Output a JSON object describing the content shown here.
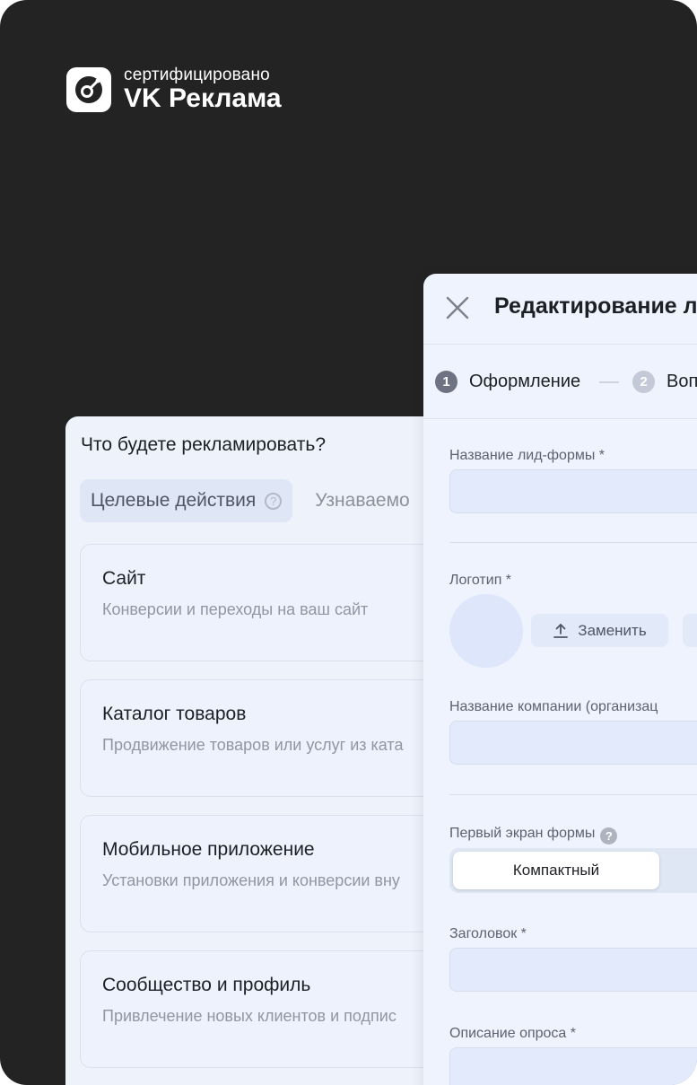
{
  "badge": {
    "subtitle": "сертифицировано",
    "title": "VK Реклама",
    "icon": "vk-ads-logo-icon"
  },
  "objective_panel": {
    "title": "Что будете рекламировать?",
    "tabs": [
      {
        "label": "Целевые действия",
        "active": true,
        "help_icon": "question-circle-icon"
      },
      {
        "label": "Узнаваемо",
        "active": false
      }
    ],
    "cards": [
      {
        "title": "Сайт",
        "description": "Конверсии и переходы на ваш сайт"
      },
      {
        "title": "Каталог товаров",
        "description": "Продвижение товаров или услуг из ката"
      },
      {
        "title": "Мобильное приложение",
        "description": "Установки приложения и конверсии вну"
      },
      {
        "title": "Сообщество и профиль",
        "description": "Привлечение новых клиентов и подпис"
      }
    ]
  },
  "editor_panel": {
    "title": "Редактирование л",
    "close_icon": "close-icon",
    "steps": [
      {
        "num": "1",
        "label": "Оформление",
        "active": true
      },
      {
        "num": "2",
        "label": "Воп",
        "active": false
      }
    ],
    "fields": {
      "form_name_label": "Название лид-формы *",
      "logo_label": "Логотип *",
      "replace_button": "Заменить",
      "company_name_label": "Название компании (организац",
      "first_screen_label": "Первый экран формы",
      "first_screen_option": "Компактный",
      "heading_label": "Заголовок *",
      "survey_desc_label": "Описание опроса *"
    }
  },
  "colors": {
    "background": "#232323",
    "panel": "#eef3fd",
    "input": "#e2eafc",
    "step_active": "#6d7382",
    "step_inactive": "#c3c9d6"
  }
}
